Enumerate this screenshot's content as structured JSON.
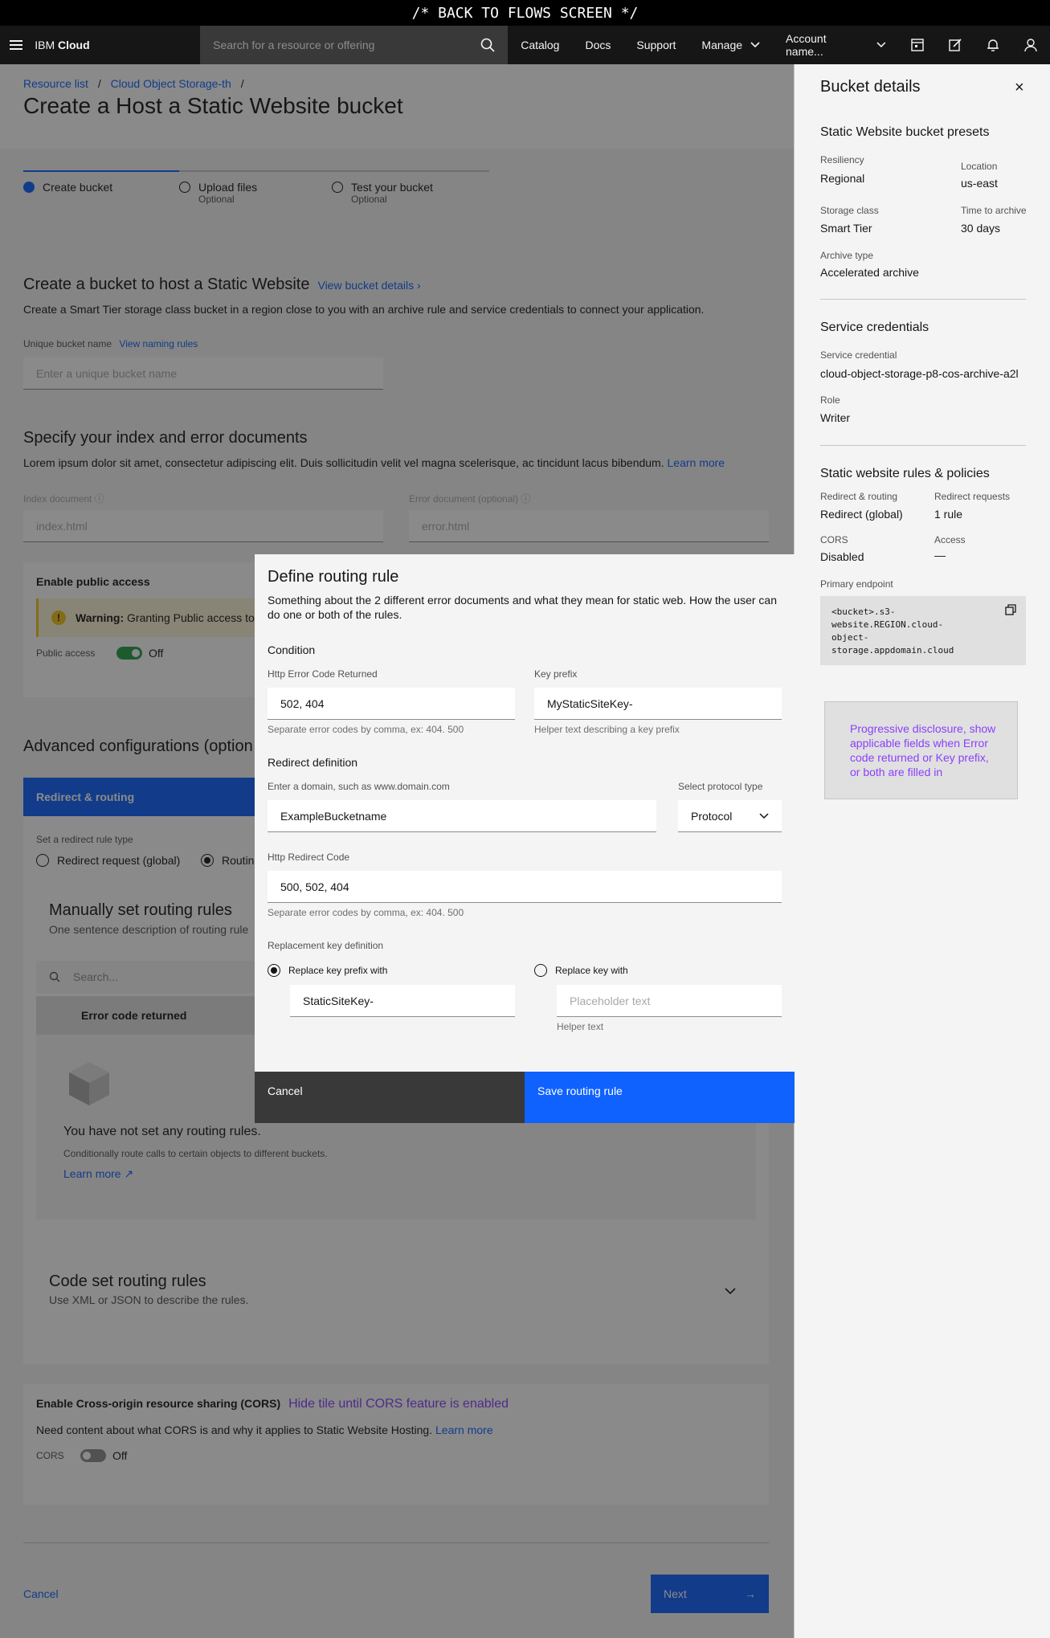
{
  "banner": "/* BACK TO FLOWS SCREEN */",
  "header": {
    "brand_prefix": "IBM",
    "brand_name": "Cloud",
    "search_placeholder": "Search for a resource or offering",
    "nav": [
      "Catalog",
      "Docs",
      "Support",
      "Manage"
    ],
    "account": "Account name..."
  },
  "breadcrumb": [
    "Resource list",
    "Cloud Object Storage-th"
  ],
  "page_title": "Create a Host a Static Website bucket",
  "progress": [
    {
      "label": "Create bucket",
      "sub": ""
    },
    {
      "label": "Upload files",
      "sub": "Optional"
    },
    {
      "label": "Test your bucket",
      "sub": "Optional"
    }
  ],
  "create_section": {
    "title": "Create a bucket to host a Static Website",
    "details_link": "View bucket details",
    "desc": "Create a Smart Tier storage class bucket in a region close to you with an archive rule and service credentials to connect your application.",
    "name_label": "Unique bucket name",
    "naming_link": "View naming rules",
    "name_placeholder": "Enter a unique bucket name"
  },
  "docs_section": {
    "title": "Specify your index and error documents",
    "desc": "Lorem ipsum dolor sit amet, consectetur adipiscing elit. Duis sollicitudin velit vel magna scelerisque, ac tincidunt lacus bibendum.",
    "learn_more": "Learn more",
    "index_label": "Index document",
    "index_placeholder": "index.html",
    "error_label": "Error document (optional)",
    "error_placeholder": "error.html"
  },
  "public_access": {
    "title": "Enable public access",
    "warning_bold": "Warning:",
    "warning_text": "Granting Public access to",
    "toggle_label": "Public access",
    "toggle_state": "Off"
  },
  "advanced": {
    "title": "Advanced configurations (option",
    "tab": "Redirect & routing",
    "rule_type_label": "Set a redirect rule type",
    "opt1": "Redirect request (global)",
    "opt2": "Routin",
    "manual_title": "Manually set routing rules",
    "manual_desc": "One sentence description of routing rule",
    "search_placeholder": "Search...",
    "col_header": "Error code returned",
    "empty_title": "You have not set any routing rules.",
    "empty_desc": "Conditionally route calls to certain objects to different buckets.",
    "empty_link": "Learn more",
    "code_title": "Code set routing rules",
    "code_desc": "Use XML or JSON to describe the rules."
  },
  "cors": {
    "title": "Enable Cross-origin resource sharing (CORS)",
    "note": "Hide tile until CORS feature is enabled",
    "desc": "Need content about what CORS is and why it applies to Static Website Hosting.",
    "learn_more": "Learn more",
    "toggle_label": "CORS",
    "toggle_state": "Off"
  },
  "footer": {
    "cancel": "Cancel",
    "next": "Next"
  },
  "side_panel": {
    "title": "Bucket details",
    "presets_title": "Static Website bucket presets",
    "resiliency_k": "Resiliency",
    "resiliency_v": "Regional",
    "location_k": "Location",
    "location_v": "us-east",
    "storage_k": "Storage class",
    "storage_v": "Smart Tier",
    "archive_time_k": "Time to archive",
    "archive_time_v": "30 days",
    "archive_type_k": "Archive type",
    "archive_type_v": "Accelerated archive",
    "cred_title": "Service credentials",
    "cred_k": "Service credential",
    "cred_v": "cloud-object-storage-p8-cos-archive-a2l",
    "role_k": "Role",
    "role_v": "Writer",
    "rules_title": "Static website rules & policies",
    "routing_k": "Redirect & routing",
    "routing_v": "Redirect (global)",
    "requests_k": "Redirect requests",
    "requests_v": "1 rule",
    "cors_k": "CORS",
    "cors_v": "Disabled",
    "access_k": "Access",
    "access_v": "—",
    "endpoint_k": "Primary endpoint",
    "endpoint_lines": [
      "<bucket>.s3-",
      "website.REGION.cloud-",
      "object-",
      "storage.appdomain.cloud"
    ]
  },
  "modal": {
    "title": "Define routing rule",
    "desc": "Something about the 2 different error documents and what they mean for static web. How the user can do one or both of the rules.",
    "condition": "Condition",
    "error_code_label": "Http Error Code Returned",
    "error_code_value": "502, 404",
    "error_code_helper": "Separate error codes by comma, ex: 404. 500",
    "key_prefix_label": "Key prefix",
    "key_prefix_value": "MyStaticSiteKey-",
    "key_prefix_helper": "Helper text describing a key prefix",
    "redirect_def": "Redirect definition",
    "domain_label": "Enter a domain, such as www.domain.com",
    "domain_value": "ExampleBucketname",
    "protocol_label": "Select protocol type",
    "protocol_value": "Protocol",
    "redirect_code_label": "Http Redirect Code",
    "redirect_code_value": "500, 502, 404",
    "redirect_code_helper": "Separate error codes by comma, ex: 404. 500",
    "replacement_label": "Replacement key definition",
    "replace_prefix_label": "Replace key prefix with",
    "replace_prefix_value": "StaticSiteKey-",
    "replace_key_label": "Replace key with",
    "replace_key_placeholder": "Placeholder text",
    "replace_key_helper": "Helper text",
    "cancel": "Cancel",
    "save": "Save routing rule"
  },
  "note": "Progressive disclosure, show applicable fields when Error code returned or Key prefix, or both are filled in"
}
